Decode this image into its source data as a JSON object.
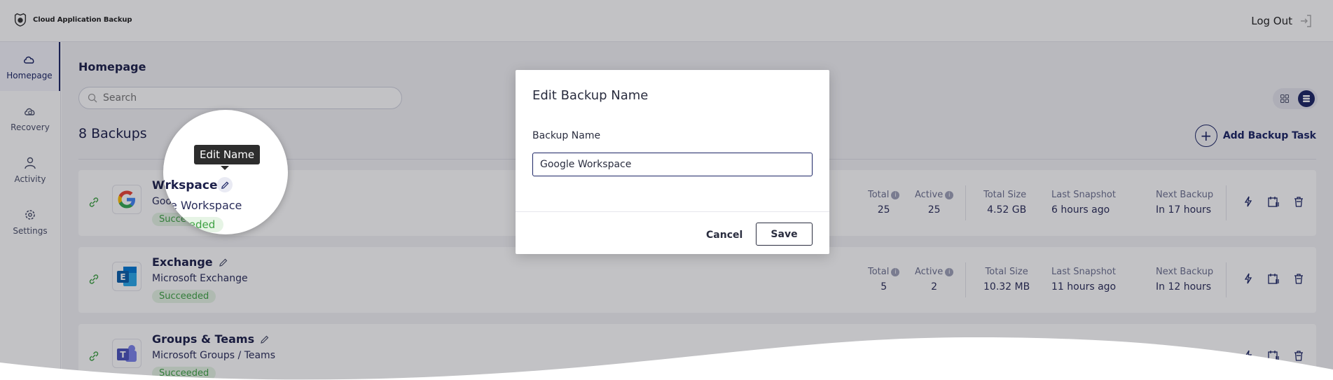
{
  "header": {
    "brand": "Cloud Application Backup",
    "logout_label": "Log Out"
  },
  "sidebar": {
    "items": [
      {
        "label": "Homepage",
        "icon": "cloud-icon",
        "active": true
      },
      {
        "label": "Recovery",
        "icon": "cloud-restore-icon",
        "active": false
      },
      {
        "label": "Activity",
        "icon": "user-icon",
        "active": false
      },
      {
        "label": "Settings",
        "icon": "gear-icon",
        "active": false
      }
    ]
  },
  "main": {
    "title": "Homepage",
    "search_placeholder": "Search",
    "backups_count": "8 Backups",
    "add_task_label": "Add Backup Task"
  },
  "stat_labels": {
    "total": "Total",
    "active": "Active",
    "total_size": "Total Size",
    "last_snapshot": "Last Snapshot",
    "next_backup": "Next Backup"
  },
  "backups": [
    {
      "name": "Workspace",
      "subtitle": "Google Workspace",
      "status": "Succeeded",
      "total": "25",
      "active": "25",
      "total_size": "4.52 GB",
      "last_snapshot": "6 hours ago",
      "next_backup": "In 17 hours"
    },
    {
      "name": "Exchange",
      "subtitle": "Microsoft Exchange",
      "status": "Succeeded",
      "total": "5",
      "active": "2",
      "total_size": "10.32 MB",
      "last_snapshot": "11 hours ago",
      "next_backup": "In 12 hours"
    },
    {
      "name": "Groups & Teams",
      "subtitle": "Microsoft Groups / Teams",
      "status": "Succeeded"
    }
  ],
  "magnifier": {
    "tooltip": "Edit Name",
    "name_fragment": "Wrkspace",
    "subtitle_fragment": "e Workspace",
    "status_fragment": "Succeeded"
  },
  "dialog": {
    "title": "Edit Backup Name",
    "field_label": "Backup Name",
    "field_value": "Google Workspace",
    "cancel_label": "Cancel",
    "save_label": "Save"
  },
  "colors": {
    "brand_navy": "#1c2565",
    "success_green": "#3fa244",
    "success_bg": "#e6f4e5"
  }
}
